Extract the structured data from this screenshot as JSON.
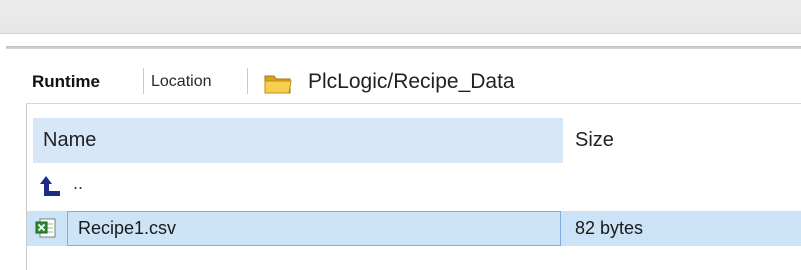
{
  "toolbar": {
    "tabs": [
      {
        "label": "Runtime",
        "active": true
      },
      {
        "label": "Location",
        "active": false
      }
    ],
    "path": "PlcLogic/Recipe_Data",
    "path_icon": "folder-icon"
  },
  "file_list": {
    "columns": [
      {
        "label": "Name"
      },
      {
        "label": "Size"
      }
    ],
    "up_entry": {
      "label": "..",
      "icon": "up-arrow-icon"
    },
    "rows": [
      {
        "name": "Recipe1.csv",
        "size": "82 bytes",
        "icon": "excel-csv-icon",
        "selected": true
      }
    ]
  },
  "colors": {
    "header_bg": "#d8e7f7",
    "selection_bg": "#cce2f6",
    "selection_border": "#7eaee0",
    "up_arrow": "#1c2a8a"
  }
}
